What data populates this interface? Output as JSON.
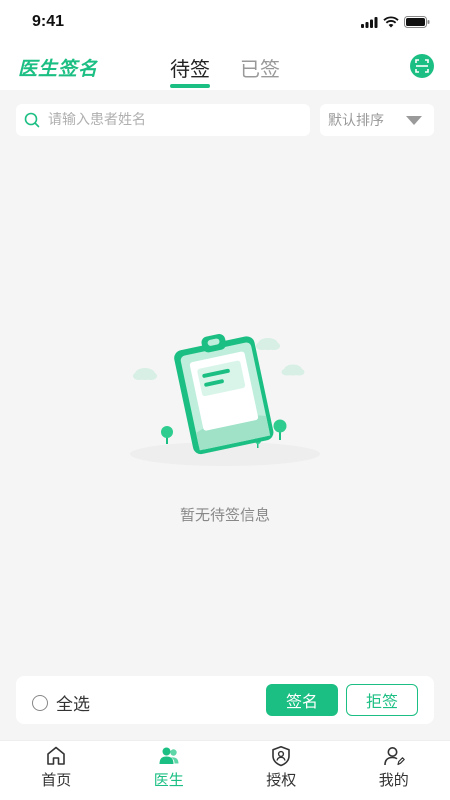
{
  "status_bar": {
    "time": "9:41"
  },
  "header": {
    "app_title": "医生签名",
    "tabs": [
      {
        "label": "待签",
        "active": true
      },
      {
        "label": "已签",
        "active": false
      }
    ]
  },
  "search": {
    "placeholder": "请输入患者姓名",
    "value": ""
  },
  "sort": {
    "selected": "默认排序"
  },
  "empty_state": {
    "message": "暂无待签信息"
  },
  "action_bar": {
    "select_all_label": "全选",
    "sign_label": "签名",
    "reject_label": "拒签"
  },
  "bottom_nav": {
    "items": [
      {
        "label": "首页",
        "icon": "home-icon",
        "active": false
      },
      {
        "label": "医生",
        "icon": "doctors-icon",
        "active": true
      },
      {
        "label": "授权",
        "icon": "authorize-icon",
        "active": false
      },
      {
        "label": "我的",
        "icon": "profile-icon",
        "active": false
      }
    ]
  },
  "colors": {
    "accent": "#1cbf83",
    "background": "#f5f5f5"
  }
}
